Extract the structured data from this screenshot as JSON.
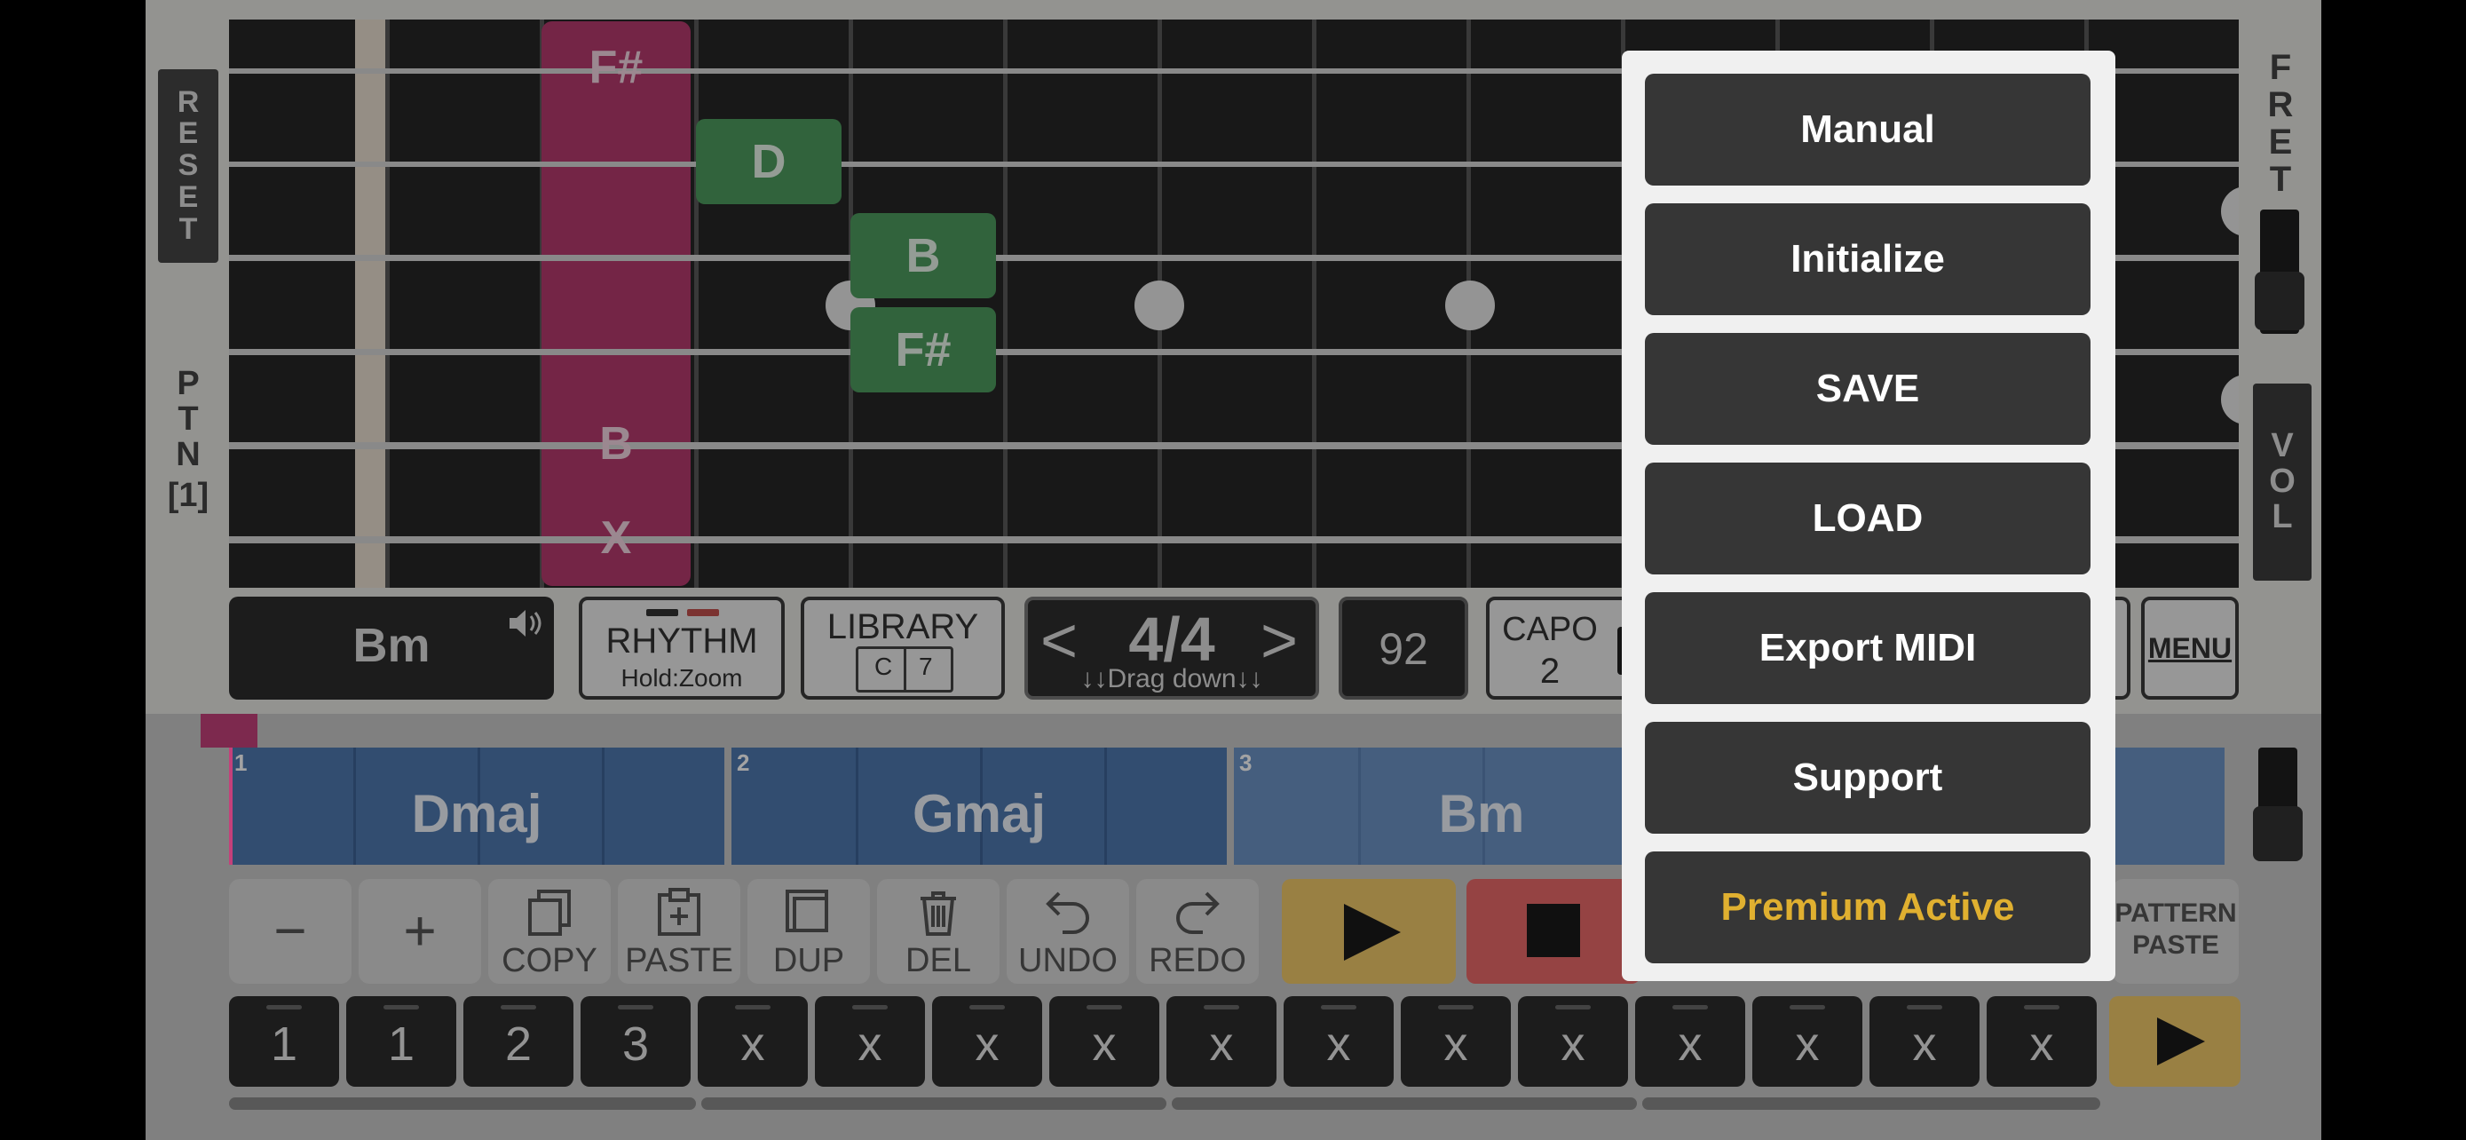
{
  "left_panel": {
    "reset_letters": [
      "R",
      "E",
      "S",
      "E",
      "T"
    ],
    "ptn_letters": [
      "P",
      "T",
      "N"
    ],
    "ptn_index": "[1]"
  },
  "right_panel": {
    "fret_letters": [
      "F",
      "R",
      "E",
      "T"
    ],
    "vol_letters": [
      "V",
      "O",
      "L"
    ]
  },
  "fretboard": {
    "chord_column_notes": [
      "F#",
      "B",
      "X"
    ],
    "green_notes": [
      "D",
      "B",
      "F#"
    ]
  },
  "controls": {
    "chord": "Bm",
    "rhythm_label": "RHYTHM",
    "rhythm_sub": "Hold:Zoom",
    "library_label": "LIBRARY",
    "library_icon_letters": [
      "C",
      "7"
    ],
    "time_signature": "4/4",
    "time_sub": "↓↓Drag down↓↓",
    "tempo": "92",
    "capo_label": "CAPO",
    "capo_value": "2",
    "menu_label": "MENU"
  },
  "timeline": {
    "bars": [
      {
        "num": "1",
        "chord": "Dmaj"
      },
      {
        "num": "2",
        "chord": "Gmaj"
      },
      {
        "num": "3",
        "chord": "Bm"
      }
    ]
  },
  "toolbar": {
    "minus": "−",
    "plus": "+",
    "copy": "COPY",
    "paste": "PASTE",
    "dup": "DUP",
    "del": "DEL",
    "undo": "UNDO",
    "redo": "REDO",
    "pattern_paste_line1": "PATTERN",
    "pattern_paste_line2": "PASTE"
  },
  "pattern_cells": [
    "1",
    "1",
    "2",
    "3",
    "x",
    "x",
    "x",
    "x",
    "x",
    "x",
    "x",
    "x",
    "x",
    "x",
    "x",
    "x"
  ],
  "menu": {
    "items": [
      "Manual",
      "Initialize",
      "SAVE",
      "LOAD",
      "Export MIDI",
      "Support",
      "Premium Active"
    ],
    "premium_color": "#e0b030"
  },
  "colors": {
    "play": "#b8943f",
    "stop": "#b34a4a",
    "chord_highlight": "#b63a6e",
    "note_green": "#4e9c5f",
    "bar_blue": "#4f79b0"
  }
}
